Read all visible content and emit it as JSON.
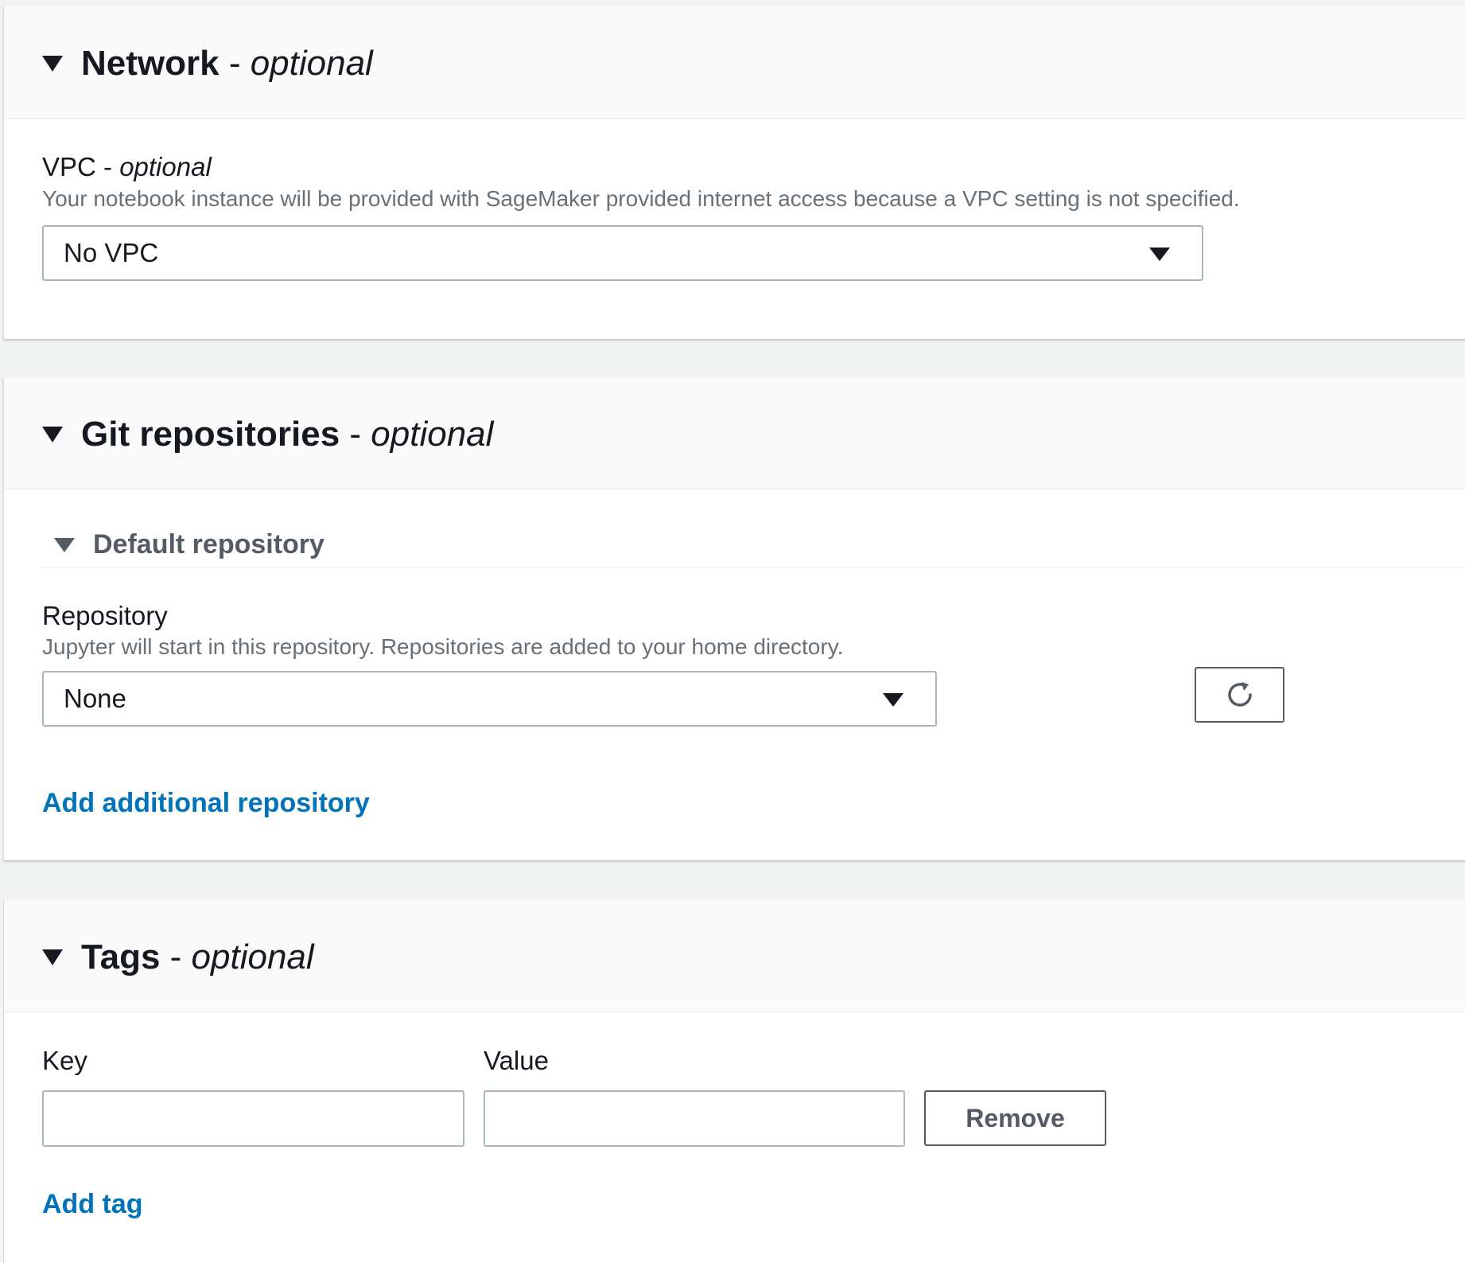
{
  "network": {
    "title": "Network",
    "separator": " - ",
    "optional": "optional",
    "vpc_label": "VPC",
    "vpc_separator": " - ",
    "vpc_optional": "optional",
    "vpc_description": "Your notebook instance will be provided with SageMaker provided internet access because a VPC setting is not specified.",
    "vpc_value": "No VPC"
  },
  "git": {
    "title": "Git repositories",
    "separator": " - ",
    "optional": "optional",
    "default_repo_title": "Default repository",
    "repository_label": "Repository",
    "repository_description": "Jupyter will start in this repository. Repositories are added to your home directory.",
    "repository_value": "None",
    "refresh_icon": "refresh-icon",
    "add_link": "Add additional repository"
  },
  "tags": {
    "title": "Tags",
    "separator": " - ",
    "optional": "optional",
    "key_label": "Key",
    "value_label": "Value",
    "key_value": "",
    "value_value": "",
    "remove_button": "Remove",
    "add_link": "Add tag"
  },
  "colors": {
    "link": "#0073bb",
    "text": "#16191f",
    "muted": "#687078",
    "border": "#aab7b8",
    "background": "#f2f3f3",
    "header_background": "#fafafa"
  }
}
